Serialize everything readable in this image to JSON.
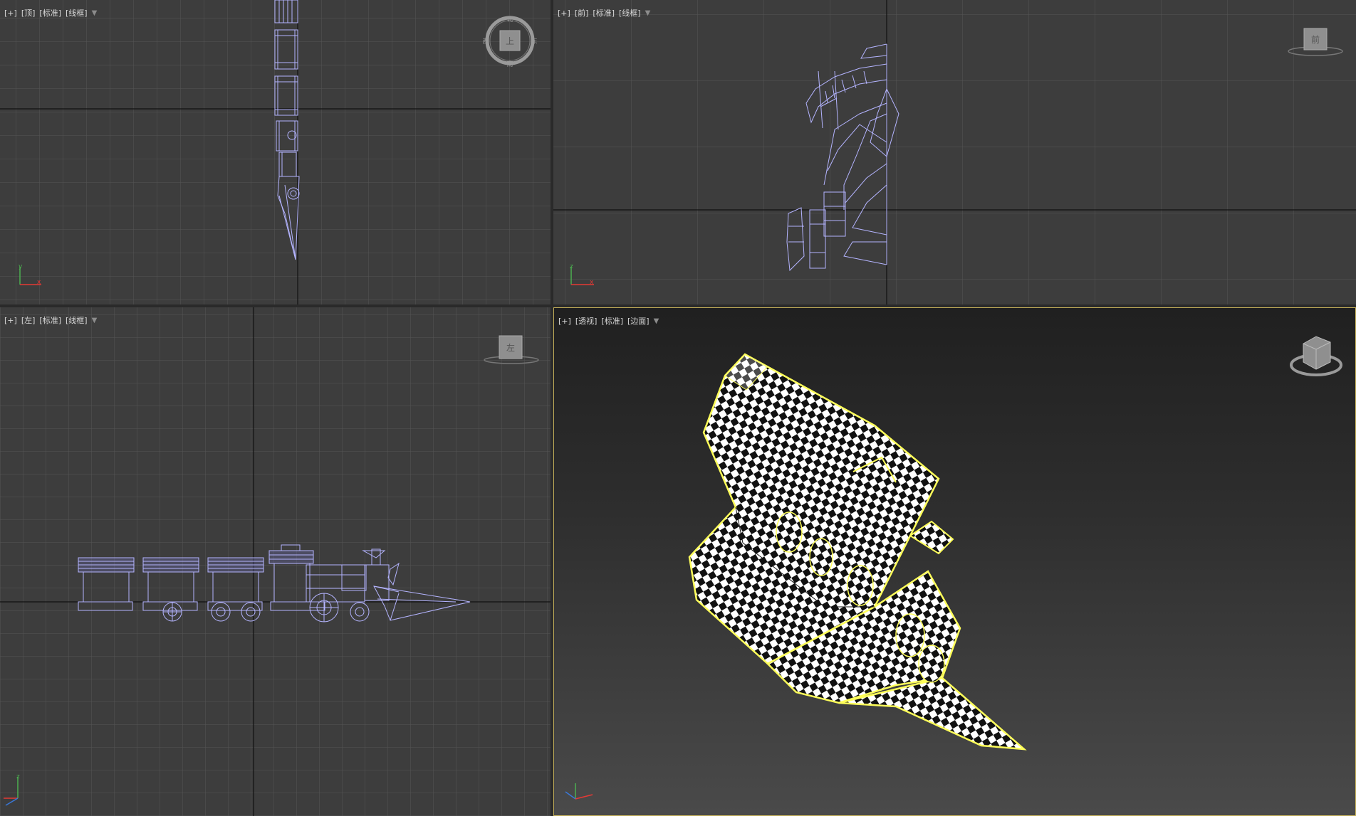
{
  "viewports": {
    "top": {
      "items": [
        "[+]",
        "[顶]",
        "[标准]",
        "[线框]"
      ],
      "cube": "上",
      "compass": {
        "n": "北",
        "s": "南",
        "e": "东",
        "w": "西"
      }
    },
    "front": {
      "items": [
        "[+]",
        "[前]",
        "[标准]",
        "[线框]"
      ],
      "cube": "前"
    },
    "left": {
      "items": [
        "[+]",
        "[左]",
        "[标准]",
        "[线框]"
      ],
      "cube": "左"
    },
    "persp": {
      "items": [
        "[+]",
        "[透视]",
        "[标准]",
        "[边面]"
      ]
    }
  },
  "colors": {
    "wire": "#b4b4ff",
    "grid": "#555555",
    "axis": "#0f0f0f",
    "selection": "#ffff5a",
    "active_border": "#c8b35a"
  },
  "icons": {
    "filter": "filter-icon",
    "viewcube": "viewcube-icon",
    "axis": "axis-tripod-icon"
  }
}
